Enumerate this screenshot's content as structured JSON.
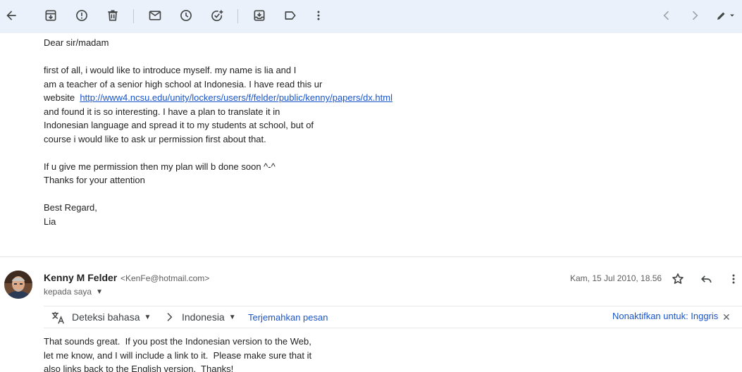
{
  "toolbar": {
    "icons": [
      "back-arrow-icon",
      "archive-icon",
      "report-spam-icon",
      "delete-icon",
      "mark-unread-icon",
      "snooze-icon",
      "add-task-icon",
      "move-to-icon",
      "label-icon",
      "more-vert-icon",
      "newer-icon",
      "older-icon",
      "edit-icon"
    ]
  },
  "message1": {
    "lines": [
      "Dear sir/madam",
      "",
      "first of all, i would like to introduce myself. my name is lia and I",
      "am a teacher of a senior high school at Indonesia. I have read this ur",
      "website  ",
      "and found it is so interesting. I have a plan to translate it in",
      "Indonesian language and spread it to my students at school, but of",
      "course i would like to ask ur permission first about that.",
      "",
      "If u give me permission then my plan will b done soon ^-^",
      "Thanks for your attention",
      "",
      "Best Regard,",
      "Lia"
    ],
    "link_text": "http://www4.ncsu.edu/unity/lockers/users/f/felder/public/kenny/papers/dx.html"
  },
  "message2": {
    "sender_name": "Kenny M Felder",
    "sender_email": "<KenFe@hotmail.com>",
    "recipient": "kepada saya",
    "date": "Kam, 15 Jul 2010, 18.56",
    "translation": {
      "source_lang": "Deteksi bahasa",
      "target_lang": "Indonesia",
      "translate_link": "Terjemahkan pesan",
      "turn_off": "Nonaktifkan untuk: Inggris"
    },
    "lines": [
      "That sounds great.  If you post the Indonesian version to the Web,",
      "let me know, and I will include a link to it.  Please make sure that it",
      "also links back to the English version.  Thanks!"
    ]
  },
  "colors": {
    "toolbar_bg": "#eaf1fb",
    "link": "#1a55c9"
  }
}
